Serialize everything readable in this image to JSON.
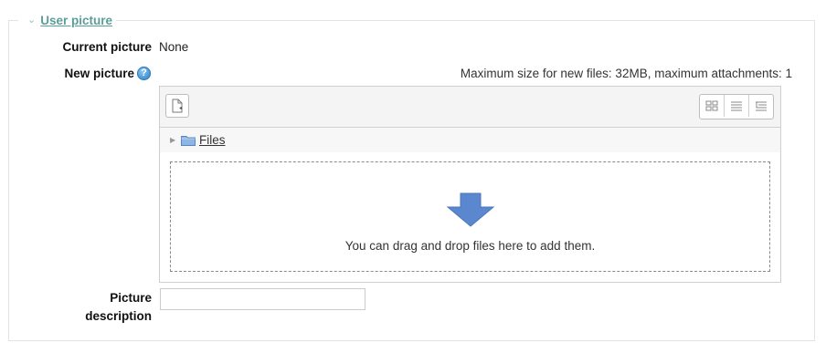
{
  "legend": {
    "label": "User picture",
    "chevron_icon": "chevron-down-icon"
  },
  "current_picture": {
    "label": "Current picture",
    "value": "None"
  },
  "new_picture": {
    "label": "New picture",
    "help_icon": "help-icon",
    "limits_text": "Maximum size for new files: 32MB, maximum attachments: 1"
  },
  "filepicker": {
    "add_icon": "add-file-icon",
    "view_icons": [
      "icons-view-icon",
      "list-view-icon",
      "tree-view-icon"
    ],
    "path": {
      "expander_icon": "expand-triangle-icon",
      "folder_icon": "folder-icon",
      "label": "Files"
    },
    "drop_arrow_icon": "down-arrow-icon",
    "drop_message": "You can drag and drop files here to add them."
  },
  "description": {
    "label_line1": "Picture",
    "label_line2": "description",
    "value": ""
  },
  "colors": {
    "legend_link": "#5a9e9a",
    "arrow": "#5b87cf",
    "border": "#cfcfcf"
  }
}
